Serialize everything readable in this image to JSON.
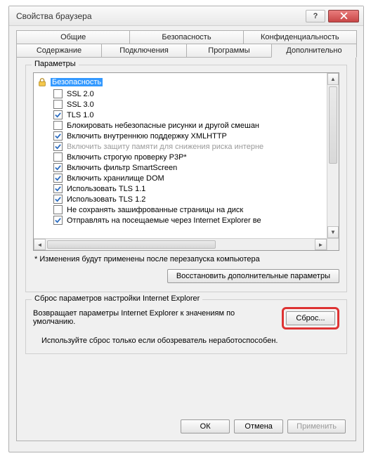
{
  "window": {
    "title": "Свойства браузера"
  },
  "tabs": {
    "row1": [
      "Общие",
      "Безопасность",
      "Конфиденциальность"
    ],
    "row2": [
      "Содержание",
      "Подключения",
      "Программы",
      "Дополнительно"
    ],
    "active": "Дополнительно"
  },
  "params": {
    "group_title": "Параметры",
    "category_icon": "lock-icon",
    "category_label": "Безопасность",
    "items": [
      {
        "label": "SSL 2.0",
        "checked": false,
        "disabled": false
      },
      {
        "label": "SSL 3.0",
        "checked": false,
        "disabled": false
      },
      {
        "label": "TLS 1.0",
        "checked": true,
        "disabled": false
      },
      {
        "label": "Блокировать небезопасные рисунки и другой смешан",
        "checked": false,
        "disabled": false
      },
      {
        "label": "Включить внутреннюю поддержку XMLHTTP",
        "checked": true,
        "disabled": false
      },
      {
        "label": "Включить защиту памяти для снижения риска интерне",
        "checked": true,
        "disabled": true
      },
      {
        "label": "Включить строгую проверку P3P*",
        "checked": false,
        "disabled": false
      },
      {
        "label": "Включить фильтр SmartScreen",
        "checked": true,
        "disabled": false
      },
      {
        "label": "Включить хранилище DOM",
        "checked": true,
        "disabled": false
      },
      {
        "label": "Использовать TLS 1.1",
        "checked": true,
        "disabled": false
      },
      {
        "label": "Использовать TLS 1.2",
        "checked": true,
        "disabled": false
      },
      {
        "label": "Не сохранять зашифрованные страницы на диск",
        "checked": false,
        "disabled": false
      },
      {
        "label": "Отправлять на посещаемые через Internet Explorer ве",
        "checked": true,
        "disabled": false
      }
    ],
    "note": "* Изменения будут применены после перезапуска компьютера",
    "restore_btn": "Восстановить дополнительные параметры"
  },
  "reset": {
    "group_title": "Сброс параметров настройки Internet Explorer",
    "desc": "Возвращает параметры Internet Explorer к значениям по умолчанию.",
    "btn": "Сброс...",
    "note": "Используйте сброс только если обозреватель неработоспособен."
  },
  "footer": {
    "ok": "ОК",
    "cancel": "Отмена",
    "apply": "Применить"
  }
}
